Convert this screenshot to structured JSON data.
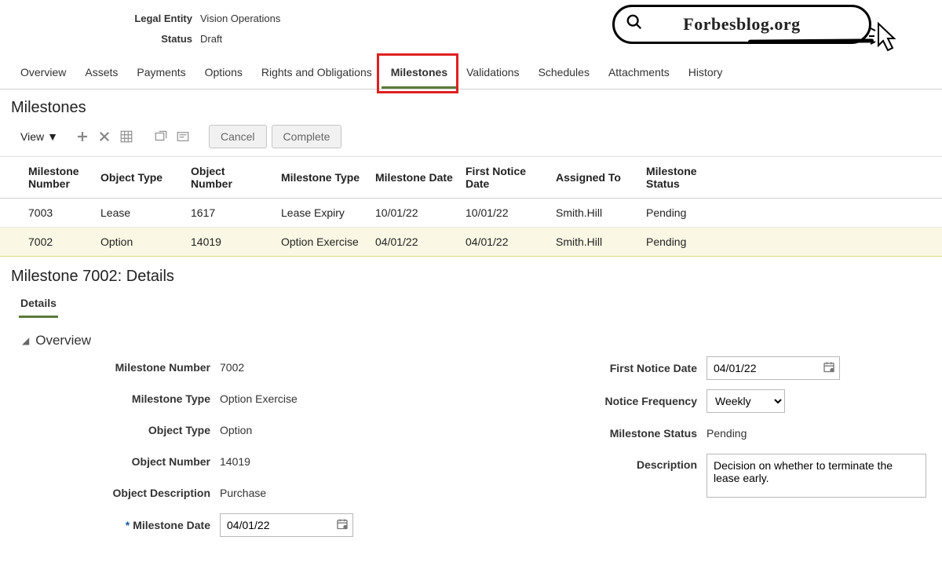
{
  "watermark": {
    "text": "Forbesblog.org"
  },
  "header": {
    "legal_entity_label": "Legal Entity",
    "legal_entity_value": "Vision Operations",
    "status_label": "Status",
    "status_value": "Draft"
  },
  "tabs": [
    {
      "label": "Overview",
      "active": false
    },
    {
      "label": "Assets",
      "active": false
    },
    {
      "label": "Payments",
      "active": false
    },
    {
      "label": "Options",
      "active": false
    },
    {
      "label": "Rights and Obligations",
      "active": false
    },
    {
      "label": "Milestones",
      "active": true
    },
    {
      "label": "Validations",
      "active": false
    },
    {
      "label": "Schedules",
      "active": false
    },
    {
      "label": "Attachments",
      "active": false
    },
    {
      "label": "History",
      "active": false
    }
  ],
  "milestones_title": "Milestones",
  "toolbar": {
    "view_label": "View",
    "cancel_label": "Cancel",
    "complete_label": "Complete"
  },
  "columns": {
    "c0": "Milestone Number",
    "c1": "Object Type",
    "c2": "Object Number",
    "c3": "Milestone Type",
    "c4": "Milestone Date",
    "c5": "First Notice Date",
    "c6": "Assigned To",
    "c7": "Milestone Status"
  },
  "rows": [
    {
      "num": "7003",
      "otype": "Lease",
      "onum": "1617",
      "mtype": "Lease Expiry",
      "mdate": "10/01/22",
      "fndate": "10/01/22",
      "assigned": "Smith.Hill",
      "status": "Pending",
      "selected": false
    },
    {
      "num": "7002",
      "otype": "Option",
      "onum": "14019",
      "mtype": "Option Exercise",
      "mdate": "04/01/22",
      "fndate": "04/01/22",
      "assigned": "Smith.Hill",
      "status": "Pending",
      "selected": true
    }
  ],
  "details": {
    "title": "Milestone 7002: Details",
    "subtab_label": "Details",
    "overview_label": "Overview",
    "left": {
      "milestone_number_label": "Milestone Number",
      "milestone_number_value": "7002",
      "milestone_type_label": "Milestone Type",
      "milestone_type_value": "Option Exercise",
      "object_type_label": "Object Type",
      "object_type_value": "Option",
      "object_number_label": "Object Number",
      "object_number_value": "14019",
      "object_desc_label": "Object Description",
      "object_desc_value": "Purchase",
      "milestone_date_label": "Milestone Date",
      "milestone_date_value": "04/01/22"
    },
    "right": {
      "first_notice_label": "First Notice Date",
      "first_notice_value": "04/01/22",
      "notice_freq_label": "Notice Frequency",
      "notice_freq_value": "Weekly",
      "milestone_status_label": "Milestone Status",
      "milestone_status_value": "Pending",
      "description_label": "Description",
      "description_value": "Decision on whether to terminate the lease early."
    }
  }
}
